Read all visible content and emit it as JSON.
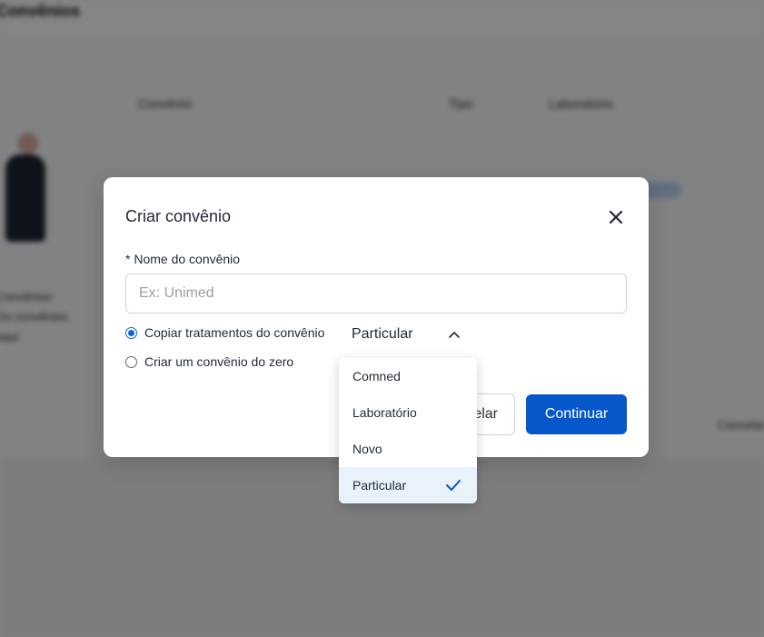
{
  "background": {
    "header_title": "Convênios",
    "table_headers": [
      "Convênio",
      "Tipo",
      "Laboratório"
    ],
    "text_lines": [
      "Convênios",
      "Os convênios",
      "aqui"
    ],
    "side_text": "Cancelar"
  },
  "modal": {
    "title": "Criar convênio",
    "field_label": "* Nome do convênio",
    "name_placeholder": "Ex: Unimed",
    "name_value": "",
    "radio_copy_label": "Copiar tratamentos do convênio",
    "radio_zero_label": "Criar um convênio do zero",
    "selected_option": "Particular",
    "cancel_label": "elar",
    "continue_label": "Continuar"
  },
  "dropdown": {
    "options": [
      "Comned",
      "Laboratório",
      "Novo",
      "Particular"
    ],
    "selected": "Particular"
  },
  "colors": {
    "accent": "#0657c9",
    "selected_bg": "#e9f1fb",
    "overlay": "rgba(0,0,0,0.47)"
  },
  "icons": {
    "close": "close-icon",
    "chevron": "chevron-up-icon",
    "check": "check-icon"
  }
}
